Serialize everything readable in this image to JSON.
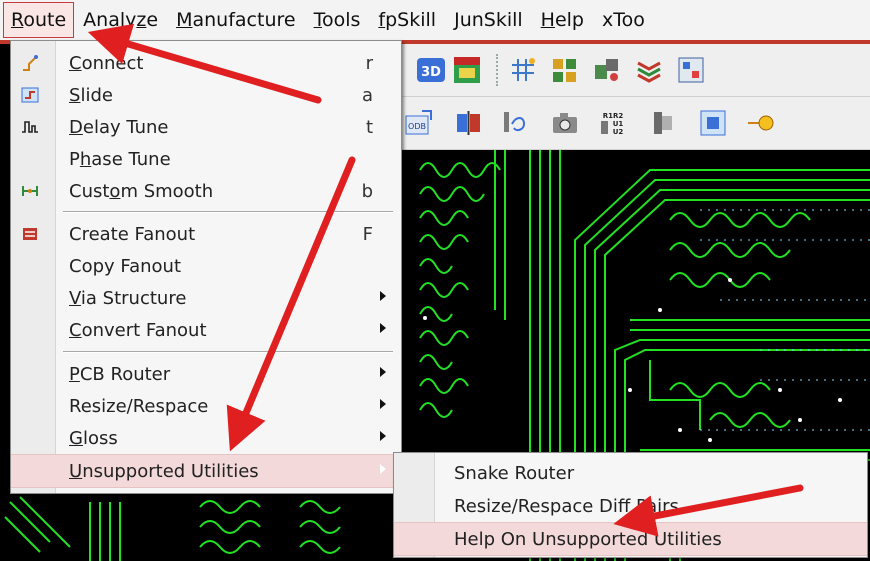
{
  "menubar": {
    "items": [
      {
        "label": "Route",
        "key": "R",
        "rest": "oute"
      },
      {
        "label": "Analyze",
        "key": "",
        "rest": "Analyze"
      },
      {
        "label": "Manufacture",
        "key": "M",
        "rest": "anufacture"
      },
      {
        "label": "Tools",
        "key": "T",
        "rest": "ools"
      },
      {
        "label": "fpSkill",
        "key": "f",
        "rest": "pSkill"
      },
      {
        "label": "JunSkill",
        "key": "J",
        "rest": "unSkill"
      },
      {
        "label": "Help",
        "key": "H",
        "rest": "elp"
      },
      {
        "label": "xToo",
        "key": "",
        "rest": "xToo"
      }
    ]
  },
  "route_menu": {
    "items": [
      {
        "pre": "",
        "key": "C",
        "post": "onnect",
        "label": "Connect",
        "shortcut": "r",
        "icon": "connect-icon"
      },
      {
        "pre": "",
        "key": "S",
        "post": "lide",
        "label": "Slide",
        "shortcut": "a",
        "icon": "slide-icon"
      },
      {
        "pre": "",
        "key": "D",
        "post": "elay Tune",
        "label": "Delay Tune",
        "shortcut": "t",
        "icon": "delay-tune-icon"
      },
      {
        "pre": "P",
        "key": "h",
        "post": "ase Tune",
        "label": "Phase Tune",
        "shortcut": "",
        "icon": ""
      },
      {
        "pre": "Cust",
        "key": "o",
        "post": "m Smooth",
        "label": "Custom Smooth",
        "shortcut": "b",
        "icon": "custom-smooth-icon"
      },
      {
        "pre": "Create Fanout",
        "key": "",
        "post": "",
        "label": "Create Fanout",
        "shortcut": "F",
        "icon": "create-fanout-icon"
      },
      {
        "pre": "Copy Fanout",
        "key": "",
        "post": "",
        "label": "Copy Fanout",
        "shortcut": "",
        "icon": ""
      },
      {
        "pre": "",
        "key": "V",
        "post": "ia Structure",
        "label": "Via Structure",
        "submenu": true
      },
      {
        "pre": "",
        "key": "C",
        "post": "onvert Fanout",
        "label": "Convert Fanout",
        "submenu": true
      },
      {
        "pre": "",
        "key": "P",
        "post": "CB Router",
        "label": "PCB Router",
        "submenu": true
      },
      {
        "pre": "Resize/Respace",
        "key": "",
        "post": "",
        "label": "Resize/Respace",
        "submenu": true
      },
      {
        "pre": "",
        "key": "G",
        "post": "loss",
        "label": "Gloss",
        "submenu": true
      },
      {
        "pre": "",
        "key": "U",
        "post": "nsupported Utilities",
        "label": "Unsupported Utilities",
        "submenu": true,
        "highlighted": true
      }
    ]
  },
  "submenu": {
    "items": [
      {
        "label": "Snake Router"
      },
      {
        "label": "Resize/Respace Diff Pairs"
      },
      {
        "label": "Help On Unsupported Utilities",
        "highlighted": true
      }
    ]
  },
  "colors": {
    "trace": "#22e022",
    "annotation_arrow": "#e02020",
    "menu_highlight": "#f3d9d9",
    "menubar_accent": "#c0392b"
  }
}
